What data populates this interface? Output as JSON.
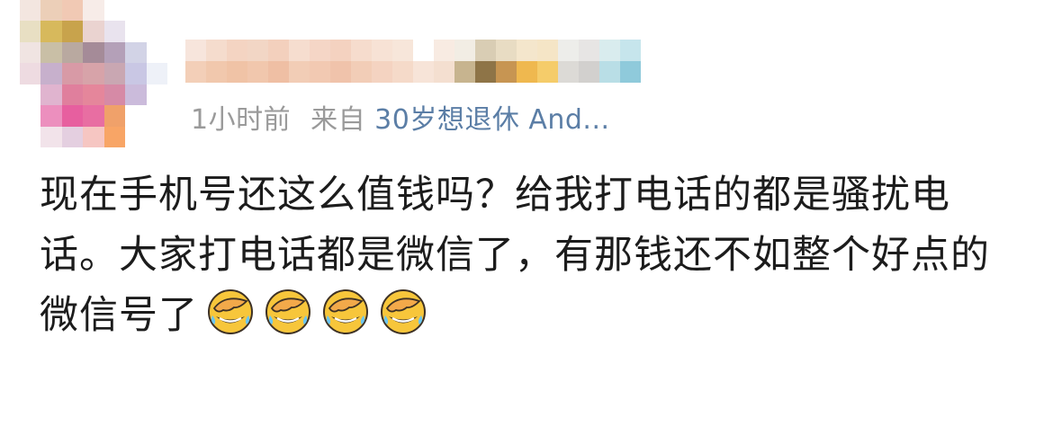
{
  "post": {
    "meta": {
      "time": "1小时前",
      "source_prefix": "来自",
      "source_device": "30岁想退休 And..."
    },
    "content_text": "现在手机号还这么值钱吗？给我打电话的都是骚扰电话。大家打电话都是微信了，有那钱还不如整个好点的微信号了",
    "emojis": [
      "facepalm-laugh-emoji",
      "facepalm-laugh-emoji",
      "facepalm-laugh-emoji",
      "facepalm-laugh-emoji"
    ]
  },
  "colors": {
    "meta_gray": "#9a9a9a",
    "link_blue": "#5b7ea6",
    "text_dark": "#1c1c1c",
    "emoji_yellow": "#f7c63b"
  }
}
